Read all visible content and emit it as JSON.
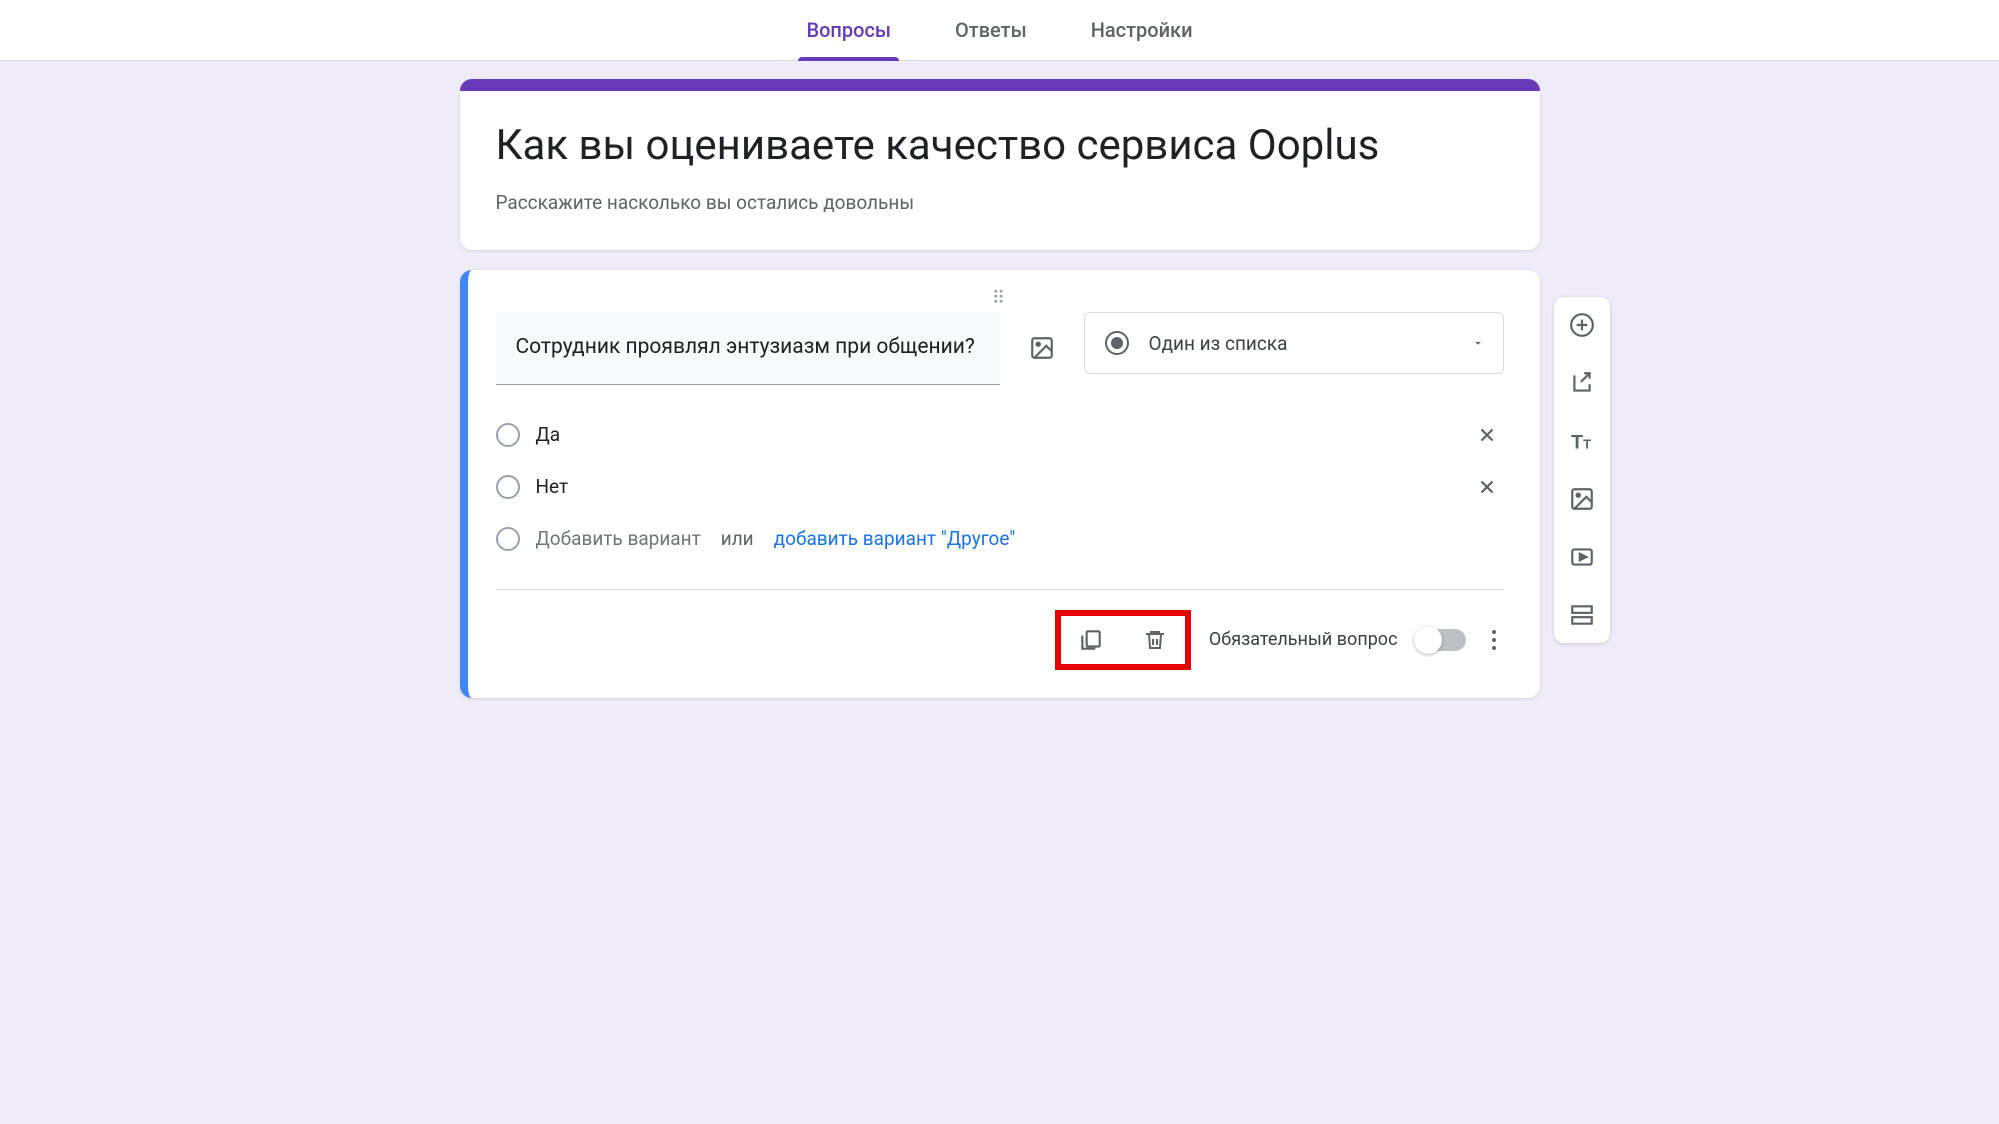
{
  "tabs": {
    "questions": "Вопросы",
    "answers": "Ответы",
    "settings": "Настройки"
  },
  "form": {
    "title": "Как вы оцениваете качество сервиса Ooplus",
    "description": "Расскажите насколько вы остались довольны"
  },
  "question": {
    "text": "Сотрудник проявлял энтузиазм при общении?",
    "type_label": "Один из списка",
    "options": [
      {
        "label": "Да"
      },
      {
        "label": "Нет"
      }
    ],
    "add_option_placeholder": "Добавить вариант",
    "or_text": "или",
    "add_other_label": "добавить вариант \"Другое\"",
    "required_label": "Обязательный вопрос"
  },
  "icons": {
    "add_question": "add-circle",
    "import": "import",
    "title_desc": "text",
    "add_image": "image",
    "add_video": "video",
    "add_section": "section"
  }
}
